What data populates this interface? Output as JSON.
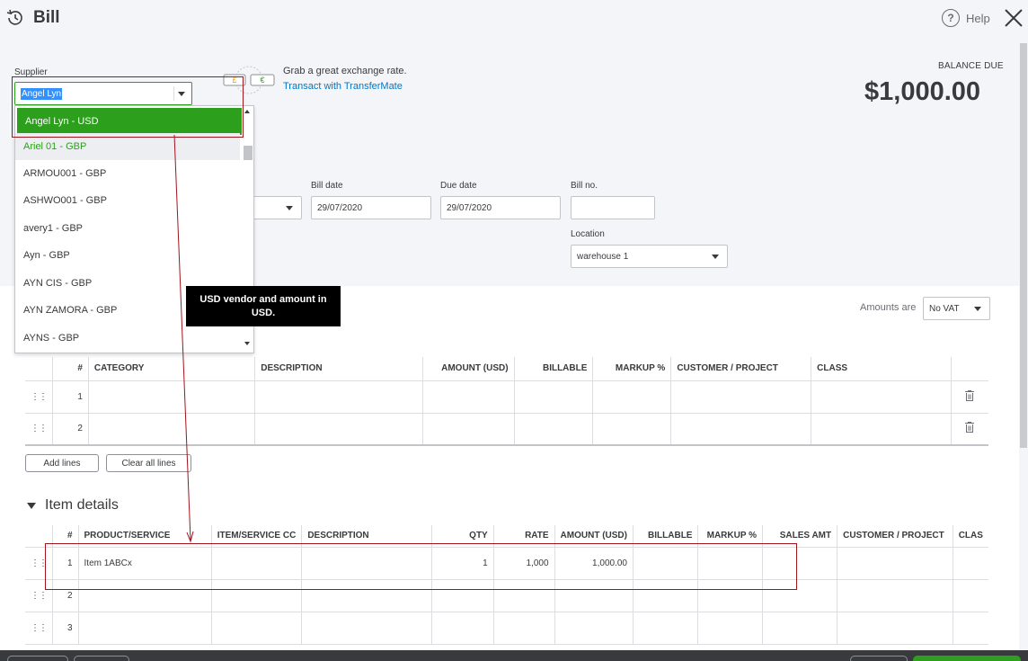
{
  "header": {
    "title": "Bill",
    "help_label": "Help"
  },
  "supplier": {
    "label": "Supplier",
    "value": "Angel Lyn",
    "options": [
      "Angel Lyn - USD",
      "Ariel 01 - GBP",
      "ARMOU001 - GBP",
      "ASHWO001 - GBP",
      "avery1 - GBP",
      "Ayn - GBP",
      "AYN CIS - GBP",
      "AYN ZAMORA - GBP",
      "AYNS - GBP"
    ]
  },
  "transfermate": {
    "text": "Grab a great exchange rate.",
    "link": "Transact with TransferMate"
  },
  "balance": {
    "label": "BALANCE DUE",
    "amount": "$1,000.00"
  },
  "dates": {
    "bill_date_label": "Bill date",
    "bill_date": "29/07/2020",
    "due_date_label": "Due date",
    "due_date": "29/07/2020",
    "bill_no_label": "Bill no.",
    "bill_no": "",
    "location_label": "Location",
    "location": "warehouse 1"
  },
  "amounts_are": {
    "label": "Amounts are",
    "value": "No VAT"
  },
  "callout": "USD vendor and amount in USD.",
  "category_table": {
    "headers": [
      "#",
      "CATEGORY",
      "DESCRIPTION",
      "AMOUNT (USD)",
      "BILLABLE",
      "MARKUP %",
      "CUSTOMER / PROJECT",
      "CLASS"
    ],
    "rows": [
      "1",
      "2"
    ]
  },
  "buttons": {
    "add_lines": "Add lines",
    "clear_all_lines": "Clear all lines"
  },
  "item_details": {
    "title": "Item details",
    "headers": [
      "#",
      "PRODUCT/SERVICE",
      "ITEM/SERVICE CC",
      "DESCRIPTION",
      "QTY",
      "RATE",
      "AMOUNT (USD)",
      "BILLABLE",
      "MARKUP %",
      "SALES AMT",
      "CUSTOMER / PROJECT",
      "CLAS"
    ],
    "rows": [
      {
        "num": "1",
        "product": "Item 1ABCx",
        "qty": "1",
        "rate": "1,000",
        "amount": "1,000.00"
      },
      {
        "num": "2",
        "product": "",
        "qty": "",
        "rate": "",
        "amount": ""
      },
      {
        "num": "3",
        "product": "",
        "qty": "",
        "rate": "",
        "amount": ""
      }
    ]
  },
  "colors": {
    "green": "#2ca01c",
    "link": "#0077c5",
    "annotation": "#a0141e"
  }
}
